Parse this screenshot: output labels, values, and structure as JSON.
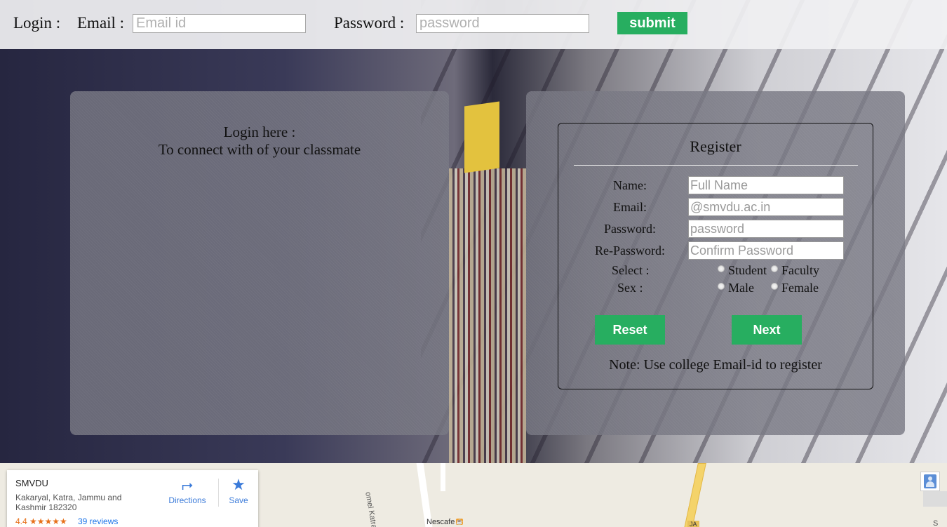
{
  "topbar": {
    "login_label": "Login :",
    "email_label": "Email :",
    "email_placeholder": "Email id",
    "password_label": "Password :",
    "password_placeholder": "password",
    "submit_label": "submit"
  },
  "left_panel": {
    "line1": "Login here :",
    "line2": "To connect with of your classmate"
  },
  "register": {
    "title": "Register",
    "fields": [
      {
        "label": "Name:",
        "placeholder": "Full Name"
      },
      {
        "label": "Email:",
        "placeholder": "@smvdu.ac.in"
      },
      {
        "label": "Password:",
        "placeholder": "password"
      },
      {
        "label": "Re-Password:",
        "placeholder": "Confirm Password"
      }
    ],
    "select_label": "Select :",
    "select_options": [
      "Student",
      "Faculty"
    ],
    "sex_label": "Sex :",
    "sex_options": [
      "Male",
      "Female"
    ],
    "reset_label": "Reset",
    "next_label": "Next",
    "note": "Note: Use college Email-id to register"
  },
  "map": {
    "place_name": "SMVDU",
    "address": "Kakaryal, Katra, Jammu and Kashmir 182320",
    "rating": "4.4 ★★★★★",
    "reviews": "39 reviews",
    "directions_label": "Directions",
    "save_label": "Save",
    "road_label": "omel Katra Route",
    "poi_label": "Nescafe",
    "highway_label": "JA",
    "edge_label": "S"
  },
  "colors": {
    "accent_green": "#27ae60",
    "map_link": "#3a7ad9"
  }
}
